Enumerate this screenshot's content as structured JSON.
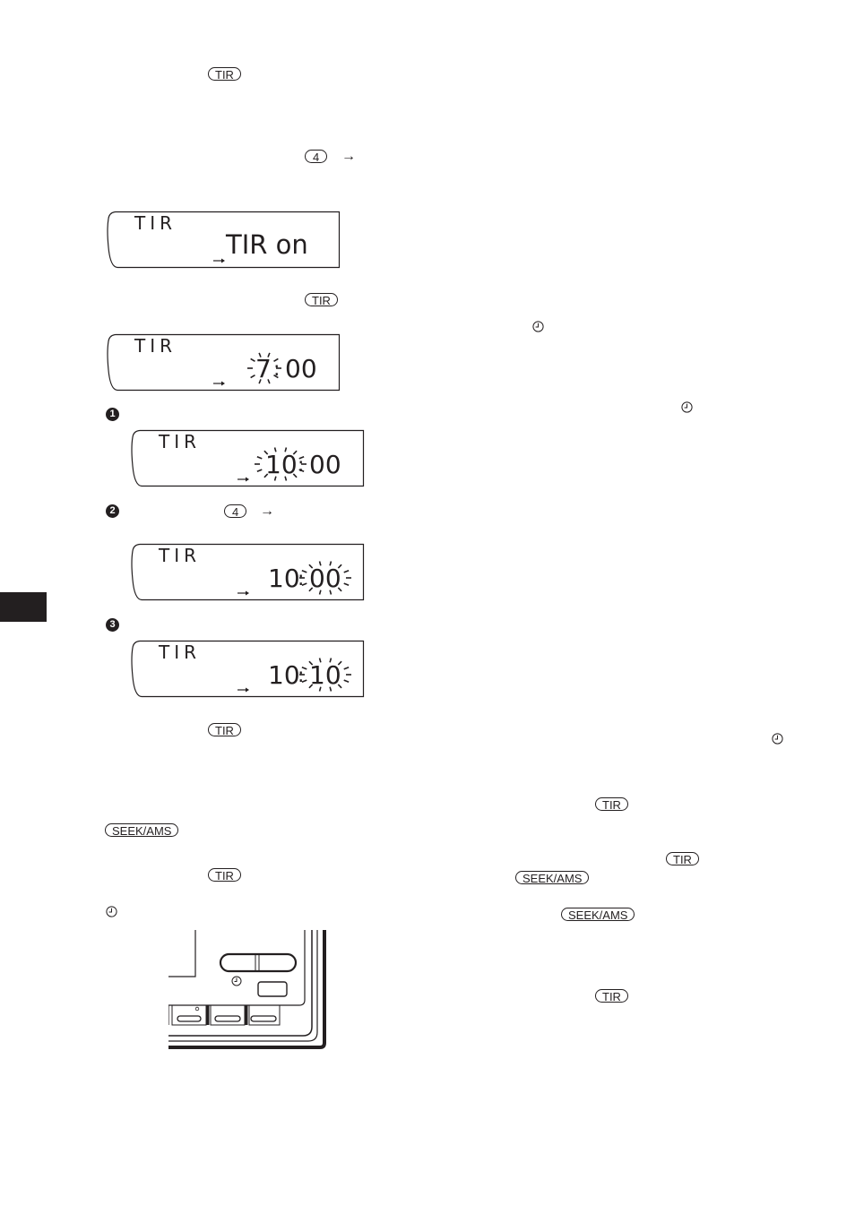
{
  "page": {
    "accent_color": "#231f20"
  },
  "keys": {
    "tir": "TIR",
    "four": "4",
    "seek_ams": "SEEK/AMS"
  },
  "arrow_glyph": "→",
  "steps": {
    "one": "1",
    "two": "2",
    "three": "3"
  },
  "displays": [
    {
      "label": "TIR",
      "value": "TIR on",
      "blink": "none"
    },
    {
      "label": "TIR",
      "hours": "7",
      "minutes": "00",
      "blink": "hours"
    },
    {
      "label": "TIR",
      "hours": "10",
      "minutes": "00",
      "blink": "hours"
    },
    {
      "label": "TIR",
      "hours": "10",
      "minutes": "00",
      "blink": "minutes"
    },
    {
      "label": "TIR",
      "hours": "10",
      "minutes": "10",
      "blink": "minutes"
    }
  ],
  "icons": {
    "clock": "clock-icon",
    "side_tab": "section-tab"
  }
}
